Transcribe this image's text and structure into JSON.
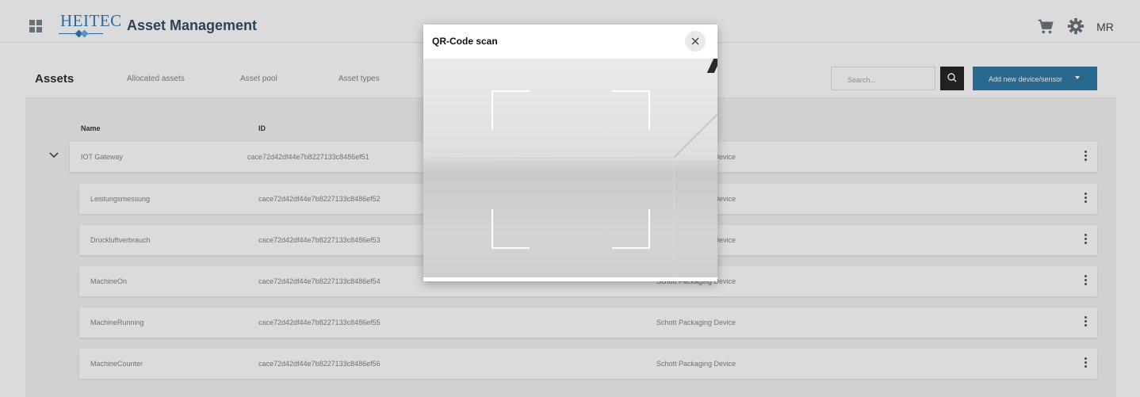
{
  "header": {
    "brand": "HEITEC",
    "title": "Asset Management",
    "user_initials": "MR"
  },
  "tabs": {
    "active": "Assets",
    "items": [
      "Allocated assets",
      "Asset pool",
      "Asset types"
    ]
  },
  "search": {
    "placeholder": "Search..."
  },
  "add_button": {
    "label": "Add new device/sensor"
  },
  "table": {
    "columns": [
      "Name",
      "ID"
    ],
    "rows": [
      {
        "name": "IOT Gateway",
        "id": "cace72d42df44e7b8227133c8486ef51",
        "type": "Schott Packaging Device"
      },
      {
        "name": "Leistungsmessung",
        "id": "cace72d42df44e7b8227133c8486ef52",
        "type": "Schott Packaging Device"
      },
      {
        "name": "Druckluftverbrauch",
        "id": "cace72d42df44e7b8227133c8486ef53",
        "type": "Schott Packaging Device"
      },
      {
        "name": "MachineOn",
        "id": "cace72d42df44e7b8227133c8486ef54",
        "type": "Schott Packaging Device"
      },
      {
        "name": "MachineRunning",
        "id": "cace72d42df44e7b8227133c8486ef55",
        "type": "Schott Packaging Device"
      },
      {
        "name": "MachineCounter",
        "id": "cace72d42df44e7b8227133c8486ef56",
        "type": "Schott Packaging Device"
      }
    ]
  },
  "modal": {
    "title": "QR-Code scan"
  },
  "colors": {
    "brand": "#1d6fb0",
    "primary_button": "#1b6e9f",
    "search_button": "#111111"
  }
}
